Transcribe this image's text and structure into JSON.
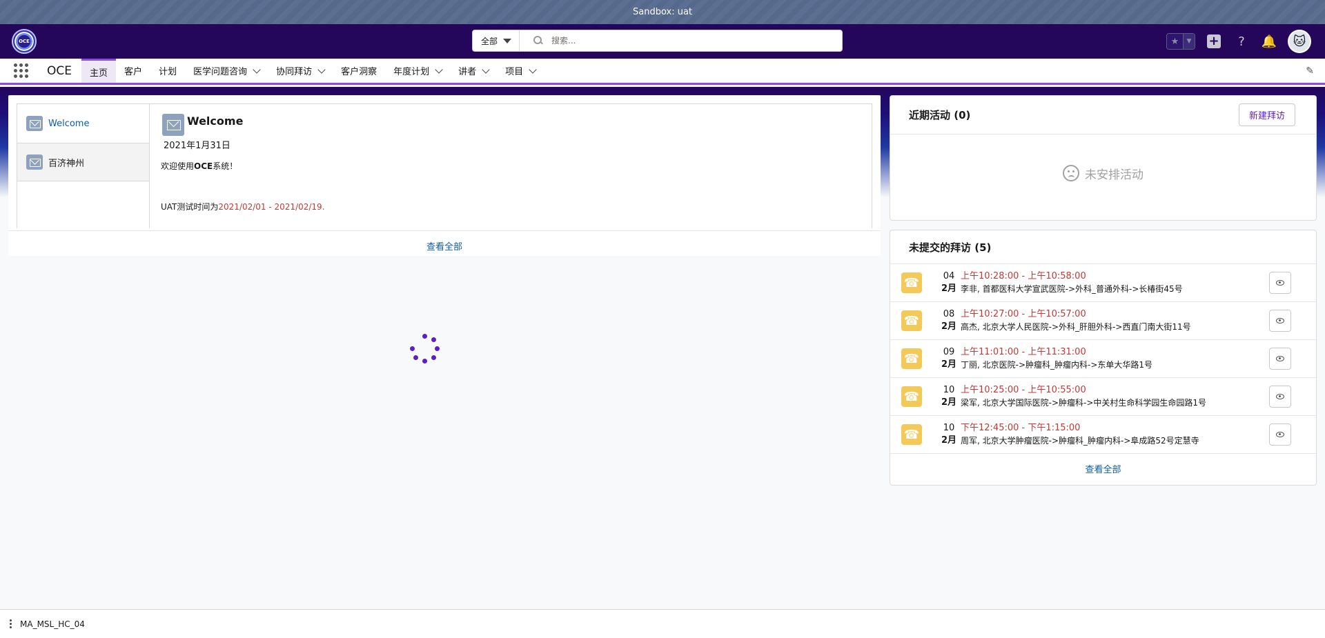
{
  "sandbox_banner": "Sandbox: uat",
  "header": {
    "logo_text": "OCE",
    "search_scope": "全部",
    "search_placeholder": "搜索..."
  },
  "nav": {
    "app_name": "OCE",
    "items": [
      {
        "label": "主页",
        "active": true,
        "dropdown": false
      },
      {
        "label": "客户",
        "active": false,
        "dropdown": false
      },
      {
        "label": "计划",
        "active": false,
        "dropdown": false
      },
      {
        "label": "医学问题咨询",
        "active": false,
        "dropdown": true
      },
      {
        "label": "协同拜访",
        "active": false,
        "dropdown": true
      },
      {
        "label": "客户洞察",
        "active": false,
        "dropdown": false
      },
      {
        "label": "年度计划",
        "active": false,
        "dropdown": true
      },
      {
        "label": "讲者",
        "active": false,
        "dropdown": true
      },
      {
        "label": "项目",
        "active": false,
        "dropdown": true
      }
    ]
  },
  "messages": {
    "list": [
      {
        "label": "Welcome",
        "selected": true
      },
      {
        "label": "百济神州",
        "selected": false
      }
    ],
    "detail": {
      "title": "Welcome",
      "date": "2021年1月31日",
      "line1_prefix": "欢迎使用",
      "line1_bold": "OCE",
      "line1_suffix": "系统！",
      "uat_prefix": "UAT测试时间为",
      "uat_range": "2021/02/01 - 2021/02/19."
    },
    "view_all": "查看全部"
  },
  "recent_activity": {
    "title": "近期活动 (0)",
    "new_button": "新建拜访",
    "empty_text": "未安排活动"
  },
  "unsubmitted_visits": {
    "title": "未提交的拜访 (5)",
    "rows": [
      {
        "day": "04",
        "month": "2月",
        "time": "上午10:28:00 - 上午10:58:00",
        "desc": "李非, 首都医科大学宣武医院->外科_普通外科->长椿街45号"
      },
      {
        "day": "08",
        "month": "2月",
        "time": "上午10:27:00 - 上午10:57:00",
        "desc": "高杰, 北京大学人民医院->外科_肝胆外科->西直门南大街11号"
      },
      {
        "day": "09",
        "month": "2月",
        "time": "上午11:01:00 - 上午11:31:00",
        "desc": "丁丽, 北京医院->肿瘤科_肿瘤内科->东单大华路1号"
      },
      {
        "day": "10",
        "month": "2月",
        "time": "上午10:25:00 - 上午10:55:00",
        "desc": "梁军, 北京大学国际医院->肿瘤科->中关村生命科学园生命园路1号"
      },
      {
        "day": "10",
        "month": "2月",
        "time": "下午12:45:00 - 下午1:15:00",
        "desc": "周军, 北京大学肿瘤医院->肿瘤科_肿瘤内科->阜成路52号定慧寺"
      }
    ],
    "view_all": "查看全部"
  },
  "footer": {
    "label": "MA_MSL_HC_04"
  },
  "colors": {
    "header_bg": "#24065a",
    "accent": "#8a4fd6",
    "time_red": "#c23934",
    "link_blue": "#0b5cab",
    "phone_yellow": "#f3c95a"
  }
}
